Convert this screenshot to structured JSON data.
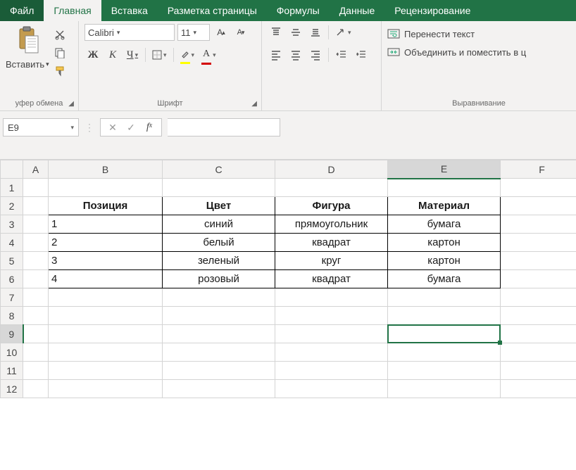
{
  "tabs": {
    "file": "Файл",
    "home": "Главная",
    "insert": "Вставка",
    "layout": "Разметка страницы",
    "formulas": "Формулы",
    "data": "Данные",
    "review": "Рецензирование"
  },
  "ribbon": {
    "clipboard": {
      "paste": "Вставить",
      "group": "уфер обмена"
    },
    "font": {
      "name": "Calibri",
      "size": "11",
      "bold": "Ж",
      "italic": "К",
      "underline": "Ч",
      "group": "Шрифт",
      "bigA": "A",
      "smallA": "A"
    },
    "align": {
      "wrap": "Перенести текст",
      "merge": "Объединить и поместить в ц",
      "group": "Выравнивание"
    }
  },
  "namebox": "E9",
  "columns": [
    "A",
    "B",
    "C",
    "D",
    "E",
    "F"
  ],
  "rows": [
    "1",
    "2",
    "3",
    "4",
    "5",
    "6",
    "7",
    "8",
    "9",
    "10",
    "11",
    "12"
  ],
  "table": {
    "headers": [
      "Позиция",
      "Цвет",
      "Фигура",
      "Материал"
    ],
    "rows": [
      [
        "1",
        "синий",
        "прямоугольник",
        "бумага"
      ],
      [
        "2",
        "белый",
        "квадрат",
        "картон"
      ],
      [
        "3",
        "зеленый",
        "круг",
        "картон"
      ],
      [
        "4",
        "розовый",
        "квадрат",
        "бумага"
      ]
    ]
  },
  "selected": {
    "col": "E",
    "row": "9"
  }
}
